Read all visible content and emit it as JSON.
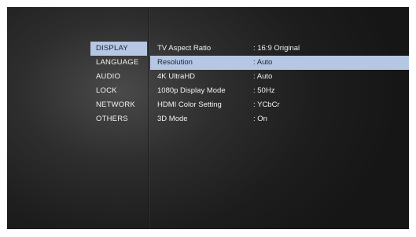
{
  "menu": {
    "selected_index": 0,
    "items": [
      {
        "label": "DISPLAY"
      },
      {
        "label": "LANGUAGE"
      },
      {
        "label": "AUDIO"
      },
      {
        "label": "LOCK"
      },
      {
        "label": "NETWORK"
      },
      {
        "label": "OTHERS"
      }
    ]
  },
  "settings": {
    "selected_index": 1,
    "rows": [
      {
        "label": "TV Aspect Ratio",
        "value": ": 16:9 Original"
      },
      {
        "label": "Resolution",
        "value": ": Auto"
      },
      {
        "label": "4K UltraHD",
        "value": ": Auto"
      },
      {
        "label": "1080p Display Mode",
        "value": ": 50Hz"
      },
      {
        "label": "HDMI Color Setting",
        "value": ": YCbCr"
      },
      {
        "label": "3D Mode",
        "value": ": On"
      }
    ]
  },
  "colors": {
    "highlight": "#b5c7e3",
    "text": "#f2f2f2",
    "highlight_text": "#1a2233"
  }
}
